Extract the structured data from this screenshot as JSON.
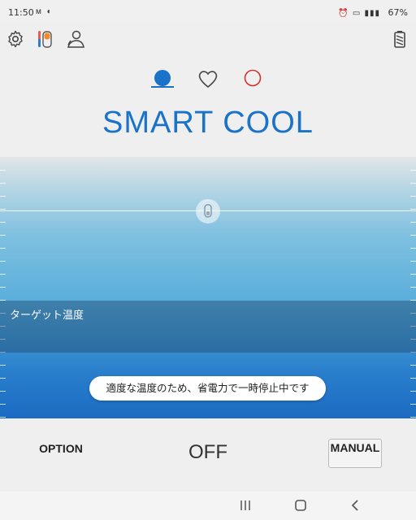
{
  "status_bar": {
    "time": "11:50",
    "battery_percent": "67%"
  },
  "mode": {
    "title": "SMART COOL",
    "selected_tab": 0
  },
  "gauge": {
    "target_label": "ターゲット温度",
    "notice": "適度な温度のため、省電力で一時停止中です"
  },
  "controls": {
    "option_label": "OPTION",
    "power_state": "OFF",
    "manual_label": "MANUAL"
  },
  "colors": {
    "accent": "#1a73c8",
    "heart_outline": "#444444",
    "circle_red": "#d32f2f"
  },
  "icons": {
    "settings": "gear-icon",
    "thermometer": "thermometer-icon",
    "person": "person-icon",
    "battery": "battery-icon"
  }
}
